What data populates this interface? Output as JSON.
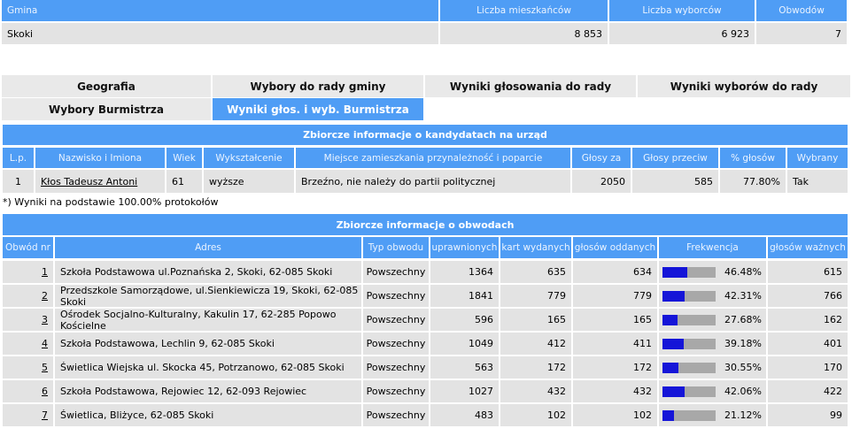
{
  "summary": {
    "headers": [
      "Gmina",
      "Liczba mieszkańców",
      "Liczba wyborców",
      "Obwodów"
    ],
    "values": [
      "Skoki",
      "8 853",
      "6 923",
      "7"
    ]
  },
  "tabs_row1": [
    {
      "label": "Geografia",
      "active": false
    },
    {
      "label": "Wybory do rady gminy",
      "active": false
    },
    {
      "label": "Wyniki głosowania do rady",
      "active": false
    },
    {
      "label": "Wyniki wyborów do rady",
      "active": false
    }
  ],
  "tabs_row2": [
    {
      "label": "Wybory Burmistrza",
      "active": false
    },
    {
      "label": "Wyniki głos. i wyb. Burmistrza",
      "active": true
    }
  ],
  "candidates": {
    "title": "Zbiorcze informacje o kandydatach na urząd",
    "headers": [
      "L.p.",
      "Nazwisko i Imiona",
      "Wiek",
      "Wykształcenie",
      "Miejsce zamieszkania przynależność i poparcie",
      "Głosy za",
      "Głosy przeciw",
      "% głosów",
      "Wybrany"
    ],
    "rows": [
      [
        "1",
        "Kłos Tadeusz Antoni",
        "61",
        "wyższe",
        "Brzeźno, nie należy do partii politycznej",
        "2050",
        "585",
        "77.80%",
        "Tak"
      ]
    ],
    "note": "*) Wyniki na podstawie 100.00% protokołów"
  },
  "districts": {
    "title": "Zbiorcze informacje o obwodach",
    "headers": [
      "Obwód nr",
      "Adres",
      "Typ obwodu",
      "uprawnionych",
      "kart wydanych",
      "głosów oddanych",
      "Frekwencja",
      "głosów ważnych"
    ],
    "rows": [
      {
        "nr": "1",
        "adres": "Szkoła Podstawowa ul.Poznańska 2, Skoki, 62-085 Skoki",
        "typ": "Powszechny",
        "uprawnionych": "1364",
        "kart": "635",
        "oddanych": "634",
        "frekwencja": "46.48%",
        "frekwencja_value": 46.48,
        "waznych": "615"
      },
      {
        "nr": "2",
        "adres": "Przedszkole Samorządowe, ul.Sienkiewicza 19, Skoki, 62-085 Skoki",
        "typ": "Powszechny",
        "uprawnionych": "1841",
        "kart": "779",
        "oddanych": "779",
        "frekwencja": "42.31%",
        "frekwencja_value": 42.31,
        "waznych": "766"
      },
      {
        "nr": "3",
        "adres": "Ośrodek Socjalno-Kulturalny, Kakulin 17, 62-285 Popowo Kościelne",
        "typ": "Powszechny",
        "uprawnionych": "596",
        "kart": "165",
        "oddanych": "165",
        "frekwencja": "27.68%",
        "frekwencja_value": 27.68,
        "waznych": "162"
      },
      {
        "nr": "4",
        "adres": "Szkoła Podstawowa, Lechlin 9, 62-085 Skoki",
        "typ": "Powszechny",
        "uprawnionych": "1049",
        "kart": "412",
        "oddanych": "411",
        "frekwencja": "39.18%",
        "frekwencja_value": 39.18,
        "waznych": "401"
      },
      {
        "nr": "5",
        "adres": "Świetlica Wiejska ul. Skocka 45, Potrzanowo, 62-085 Skoki",
        "typ": "Powszechny",
        "uprawnionych": "563",
        "kart": "172",
        "oddanych": "172",
        "frekwencja": "30.55%",
        "frekwencja_value": 30.55,
        "waznych": "170"
      },
      {
        "nr": "6",
        "adres": "Szkoła Podstawowa, Rejowiec 12, 62-093 Rejowiec",
        "typ": "Powszechny",
        "uprawnionych": "1027",
        "kart": "432",
        "oddanych": "432",
        "frekwencja": "42.06%",
        "frekwencja_value": 42.06,
        "waznych": "422"
      },
      {
        "nr": "7",
        "adres": "Świetlica, Bliżyce, 62-085 Skoki",
        "typ": "Powszechny",
        "uprawnionych": "483",
        "kart": "102",
        "oddanych": "102",
        "frekwencja": "21.12%",
        "frekwencja_value": 21.12,
        "waznych": "99"
      }
    ]
  },
  "colors": {
    "header_blue": "#4f9df5",
    "cell_gray": "#e3e3e3",
    "bar_blue": "#1515d8",
    "bar_gray": "#a8a8a8"
  }
}
